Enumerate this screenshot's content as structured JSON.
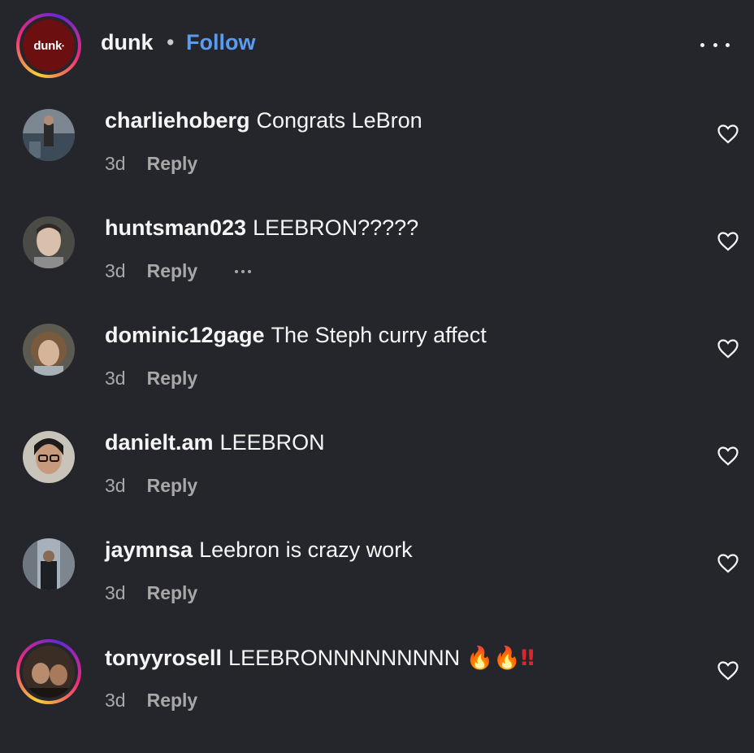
{
  "header": {
    "account_name": "dunk",
    "avatar_text": "dunk",
    "separator": "•",
    "follow_label": "Follow",
    "more_icon": "more-horizontal-icon"
  },
  "comments": [
    {
      "username": "charliehoberg",
      "text": "Congrats LeBron",
      "time": "3d",
      "reply_label": "Reply",
      "liked": false
    },
    {
      "username": "huntsman023",
      "text": "LEEBRON?????",
      "time": "3d",
      "reply_label": "Reply",
      "has_more": true,
      "liked": false
    },
    {
      "username": "dominic12gage",
      "text": "The Steph curry affect",
      "time": "3d",
      "reply_label": "Reply",
      "liked": false
    },
    {
      "username": "danielt.am",
      "text": "LEEBRON",
      "time": "3d",
      "reply_label": "Reply",
      "liked": false
    },
    {
      "username": "jaymnsa",
      "text": "Leebron is crazy work",
      "time": "3d",
      "reply_label": "Reply",
      "liked": false
    },
    {
      "username": "tonyyrosell",
      "text": "LEEBRONNNNNNNNN",
      "emoji": [
        "🔥",
        "🔥",
        "‼"
      ],
      "time": "3d",
      "reply_label": "Reply",
      "has_story_ring": true,
      "liked": false
    }
  ],
  "colors": {
    "background": "#25262b",
    "follow": "#5a9bf0",
    "brand_avatar": "#6b0f10",
    "muted_text": "#a8a8a8"
  }
}
